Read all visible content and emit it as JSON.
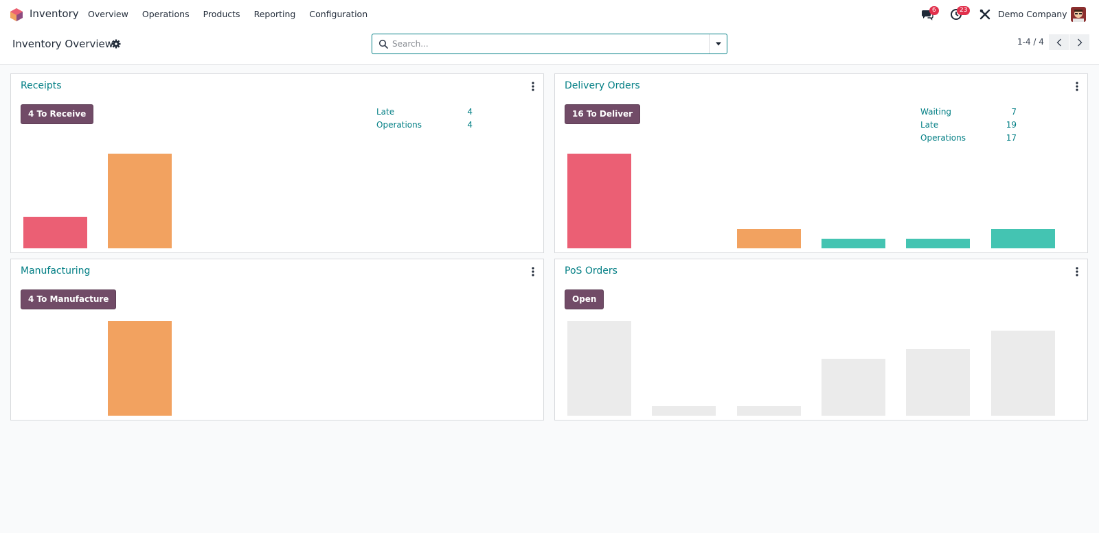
{
  "app": {
    "name": "Inventory"
  },
  "menu": [
    "Overview",
    "Operations",
    "Products",
    "Reporting",
    "Configuration"
  ],
  "systray": {
    "messages_count": "6",
    "activities_count": "23",
    "company": "Demo Company"
  },
  "control": {
    "title": "Inventory Overview",
    "search_placeholder": "Search...",
    "pager": "1-4 / 4"
  },
  "colors": {
    "brand": "#714b67",
    "link": "#017e84",
    "late": "#eb5f74",
    "waiting": "#f2a260",
    "ready": "#44c4b2",
    "placeholder": "#ebebeb"
  },
  "cards": [
    {
      "title": "Receipts",
      "button": "4 To Receive",
      "stats": [
        {
          "label": "Late",
          "value": "4"
        },
        {
          "label": "Operations",
          "value": "4"
        }
      ],
      "bars": [
        {
          "value": 1,
          "color": "late"
        },
        {
          "value": 3,
          "color": "waiting"
        }
      ]
    },
    {
      "title": "Delivery Orders",
      "button": "16 To Deliver",
      "stats": [
        {
          "label": "Waiting",
          "value": "7"
        },
        {
          "label": "Late",
          "value": "19"
        },
        {
          "label": "Operations",
          "value": "17"
        }
      ],
      "bars": [
        {
          "value": 10,
          "color": "late"
        },
        {
          "value": 0,
          "color": "late"
        },
        {
          "value": 2,
          "color": "waiting"
        },
        {
          "value": 1,
          "color": "ready"
        },
        {
          "value": 1,
          "color": "ready"
        },
        {
          "value": 2,
          "color": "ready"
        }
      ]
    },
    {
      "title": "Manufacturing",
      "button": "4 To Manufacture",
      "stats": [],
      "bars": [
        {
          "value": 0,
          "color": "late"
        },
        {
          "value": 4,
          "color": "waiting"
        }
      ]
    },
    {
      "title": "PoS Orders",
      "button": "Open",
      "stats": [],
      "bars": [
        {
          "value": 10,
          "color": "placeholder"
        },
        {
          "value": 1,
          "color": "placeholder"
        },
        {
          "value": 1,
          "color": "placeholder"
        },
        {
          "value": 6,
          "color": "placeholder"
        },
        {
          "value": 7,
          "color": "placeholder"
        },
        {
          "value": 9,
          "color": "placeholder"
        }
      ]
    }
  ]
}
